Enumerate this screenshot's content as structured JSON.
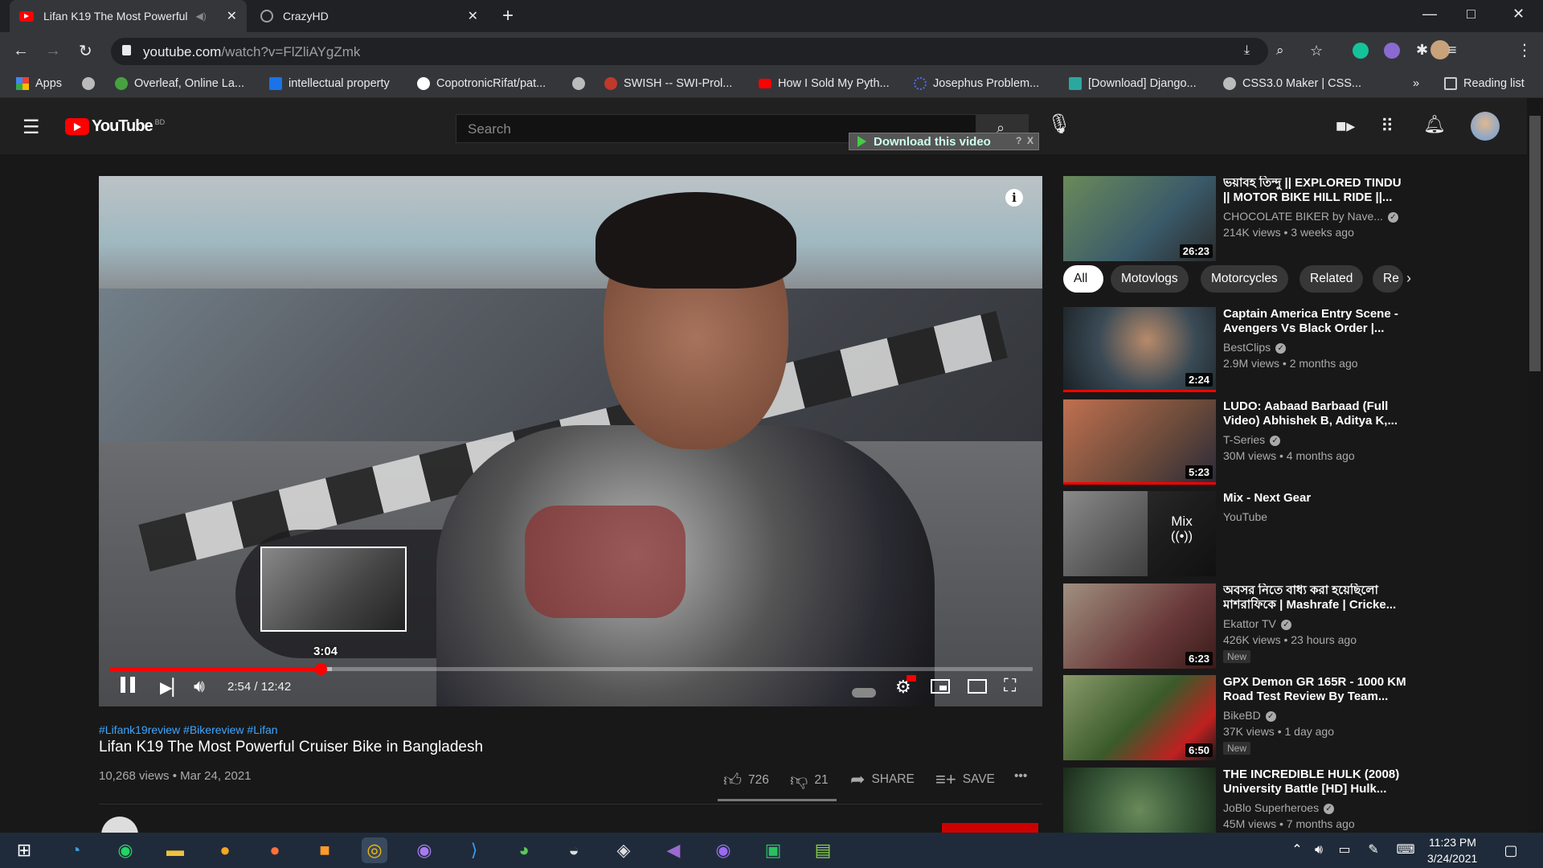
{
  "browser": {
    "tabs": [
      {
        "title": "Lifan K19 The Most Powerful",
        "icon": "youtube-favicon",
        "active": true
      },
      {
        "title": "CrazyHD",
        "icon": "globe-favicon",
        "active": false
      }
    ],
    "new_tab": "+",
    "url": {
      "host": "youtube.com",
      "path": "/watch?v=FlZliAYgZmk"
    },
    "window_controls": {
      "minimize": "—",
      "maximize": "□",
      "close": "✕"
    },
    "bookmarks": [
      {
        "label": "Apps",
        "color": "#e94235"
      },
      {
        "label": "",
        "color": "#cccccc"
      },
      {
        "label": "Overleaf, Online La...",
        "color": "#47a141"
      },
      {
        "label": "intellectual property",
        "color": "#1a73e8"
      },
      {
        "label": "CopotronicRifat/pat...",
        "color": "#ffffff"
      },
      {
        "label": "",
        "color": "#cccccc"
      },
      {
        "label": "SWISH -- SWI-Prol...",
        "color": "#c0392b"
      },
      {
        "label": "How I Sold My Pyth...",
        "color": "#ff0000"
      },
      {
        "label": "Josephus Problem...",
        "color": "#4a6cf7"
      },
      {
        "label": "[Download] Django...",
        "color": "#2aa8a0"
      },
      {
        "label": "CSS3.0 Maker | CSS...",
        "color": "#cccccc"
      }
    ],
    "bookmarks_more": "»",
    "reading_list": "Reading list"
  },
  "youtube": {
    "logo_text": "YouTube",
    "logo_region": "BD",
    "search_placeholder": "Search",
    "download_bar": "Download this video",
    "download_bar_extra": "?",
    "download_bar_close": "X",
    "brand_red": "#ff0000"
  },
  "player": {
    "current_time": "2:54",
    "duration": "12:42",
    "time_display": "2:54 / 12:42",
    "progress_fraction": 0.228,
    "buffered_fraction": 0.24,
    "hover_time": "3:04",
    "info": "i"
  },
  "video": {
    "hashtags": "#Lifank19review #Bikereview #Lifan",
    "title": "Lifan K19 The Most Powerful Cruiser Bike in Bangladesh",
    "meta": "10,268 views • Mar 24, 2021",
    "likes": "726",
    "dislikes": "21",
    "share_label": "SHARE",
    "save_label": "SAVE",
    "more": "•••"
  },
  "chips": [
    "All",
    "Motovlogs",
    "Motorcycles",
    "Related",
    "Re"
  ],
  "recommendations": [
    {
      "title": "ভয়াবহ তিন্দু || EXPLORED TINDU || MOTOR BIKE HILL RIDE ||...",
      "channel": "CHOCOLATE BIKER by Nave...",
      "verified": true,
      "views": "214K views • 3 weeks ago",
      "duration": "26:23",
      "new": false,
      "thumb_color": "#5a7a4a"
    },
    {
      "title": "Captain America Entry Scene - Avengers Vs Black Order |...",
      "channel": "BestClips",
      "verified": true,
      "views": "2.9M views • 2 months ago",
      "duration": "2:24",
      "new": false,
      "thumb_color": "#3a4a55"
    },
    {
      "title": "LUDO: Aabaad Barbaad (Full Video) Abhishek B, Aditya K,...",
      "channel": "T-Series",
      "verified": true,
      "views": "30M views • 4 months ago",
      "duration": "5:23",
      "new": false,
      "thumb_color": "#6a4a3a"
    },
    {
      "title": "Mix - Next Gear",
      "channel": "YouTube",
      "verified": false,
      "views": "",
      "duration": "",
      "mix_label": "Mix",
      "new": false,
      "thumb_color": "#4a4a4a"
    },
    {
      "title": "অবসর নিতে বাধ্য করা হয়েছিলো মাশরাফিকে | Mashrafe | Cricke...",
      "channel": "Ekattor TV",
      "verified": true,
      "views": "426K views • 23 hours ago",
      "duration": "6:23",
      "new": true,
      "thumb_color": "#6a3a3a"
    },
    {
      "title": "GPX Demon GR 165R - 1000 KM Road Test Review By Team...",
      "channel": "BikeBD",
      "verified": true,
      "views": "37K views • 1 day ago",
      "duration": "6:50",
      "new": true,
      "thumb_color": "#3a5a2a"
    },
    {
      "title": "THE INCREDIBLE HULK (2008) University Battle [HD] Hulk...",
      "channel": "JoBlo Superheroes",
      "verified": true,
      "views": "45M views • 7 months ago",
      "duration": "",
      "new": false,
      "thumb_color": "#3a5a3a"
    }
  ],
  "new_badge": "New",
  "taskbar": {
    "time": "11:23 PM",
    "date": "3/24/2021",
    "background": "#1f2b3a"
  }
}
